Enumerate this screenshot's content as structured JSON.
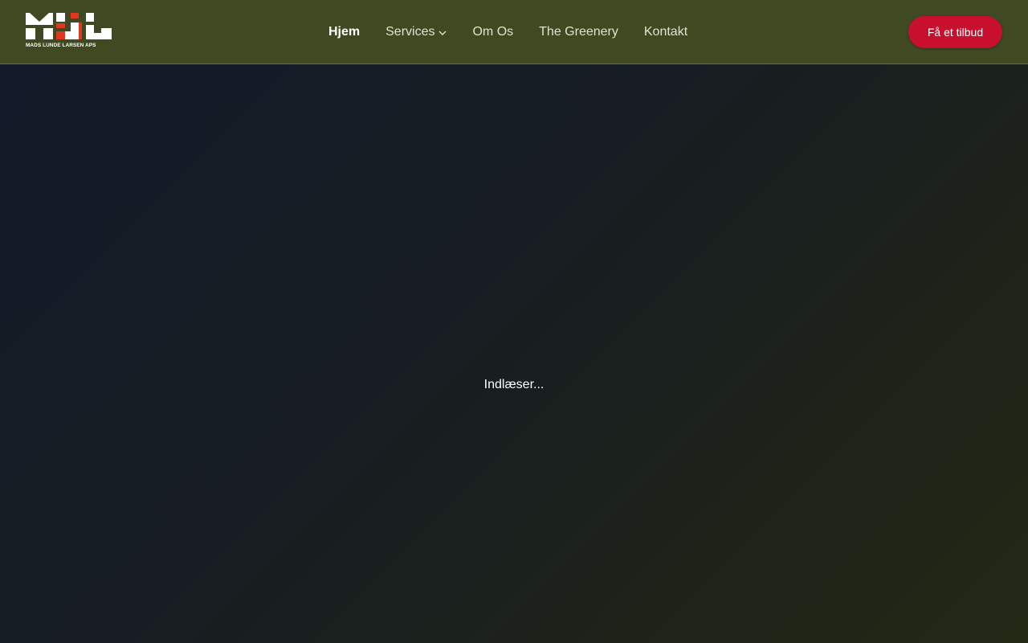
{
  "brand": {
    "logo_caption": "MADS LUNDE LARSEN APS",
    "accent_red": "#e0381f",
    "header_bg": "#3f4a23"
  },
  "nav": {
    "items": [
      {
        "label": "Hjem",
        "active": true
      },
      {
        "label": "Services",
        "has_dropdown": true
      },
      {
        "label": "Om Os"
      },
      {
        "label": "The Greenery"
      },
      {
        "label": "Kontakt"
      }
    ]
  },
  "cta": {
    "label": "Få et tilbud",
    "color": "#c8102e"
  },
  "main": {
    "loading_text": "Indlæser..."
  }
}
